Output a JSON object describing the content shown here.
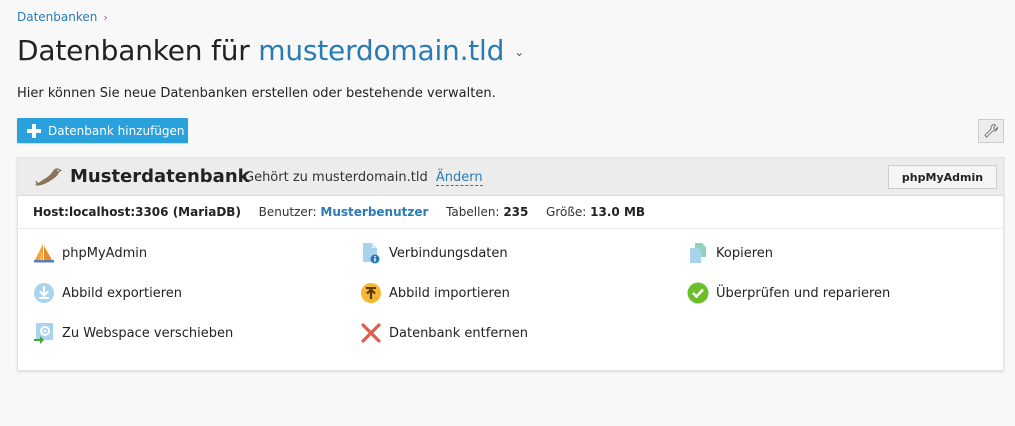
{
  "breadcrumb": {
    "label": "Datenbanken",
    "separator": "›"
  },
  "page": {
    "title_prefix": "Datenbanken für",
    "domain": "musterdomain.tld",
    "intro": "Hier können Sie neue Datenbanken erstellen oder bestehende verwalten."
  },
  "toolbar": {
    "add_label": "Datenbank hinzufügen",
    "tools_icon": "wrench-icon"
  },
  "database": {
    "name": "Musterdatenbank",
    "owner_text": "Gehört zu musterdomain.tld",
    "change_label": "Ändern",
    "phpmyadmin_button": "phpMyAdmin",
    "host": "Host:localhost:3306 (MariaDB)",
    "user_label": "Benutzer:",
    "user": "Musterbenutzer",
    "tables_label": "Tabellen:",
    "tables": "235",
    "size_label": "Größe:",
    "size": "13.0 MB",
    "actions": [
      {
        "label": "phpMyAdmin",
        "icon": "phpmyadmin-icon"
      },
      {
        "label": "Verbindungsdaten",
        "icon": "connection-info-icon"
      },
      {
        "label": "Kopieren",
        "icon": "copy-icon"
      },
      {
        "label": "Abbild exportieren",
        "icon": "export-icon"
      },
      {
        "label": "Abbild importieren",
        "icon": "import-icon"
      },
      {
        "label": "Überprüfen und reparieren",
        "icon": "check-icon"
      },
      {
        "label": "Zu Webspace verschieben",
        "icon": "move-icon"
      },
      {
        "label": "Datenbank entfernen",
        "icon": "remove-icon"
      }
    ]
  },
  "colors": {
    "accent": "#2a7bb5",
    "button": "#28a1dc",
    "danger": "#e05d4f",
    "success": "#6bbf2a"
  }
}
